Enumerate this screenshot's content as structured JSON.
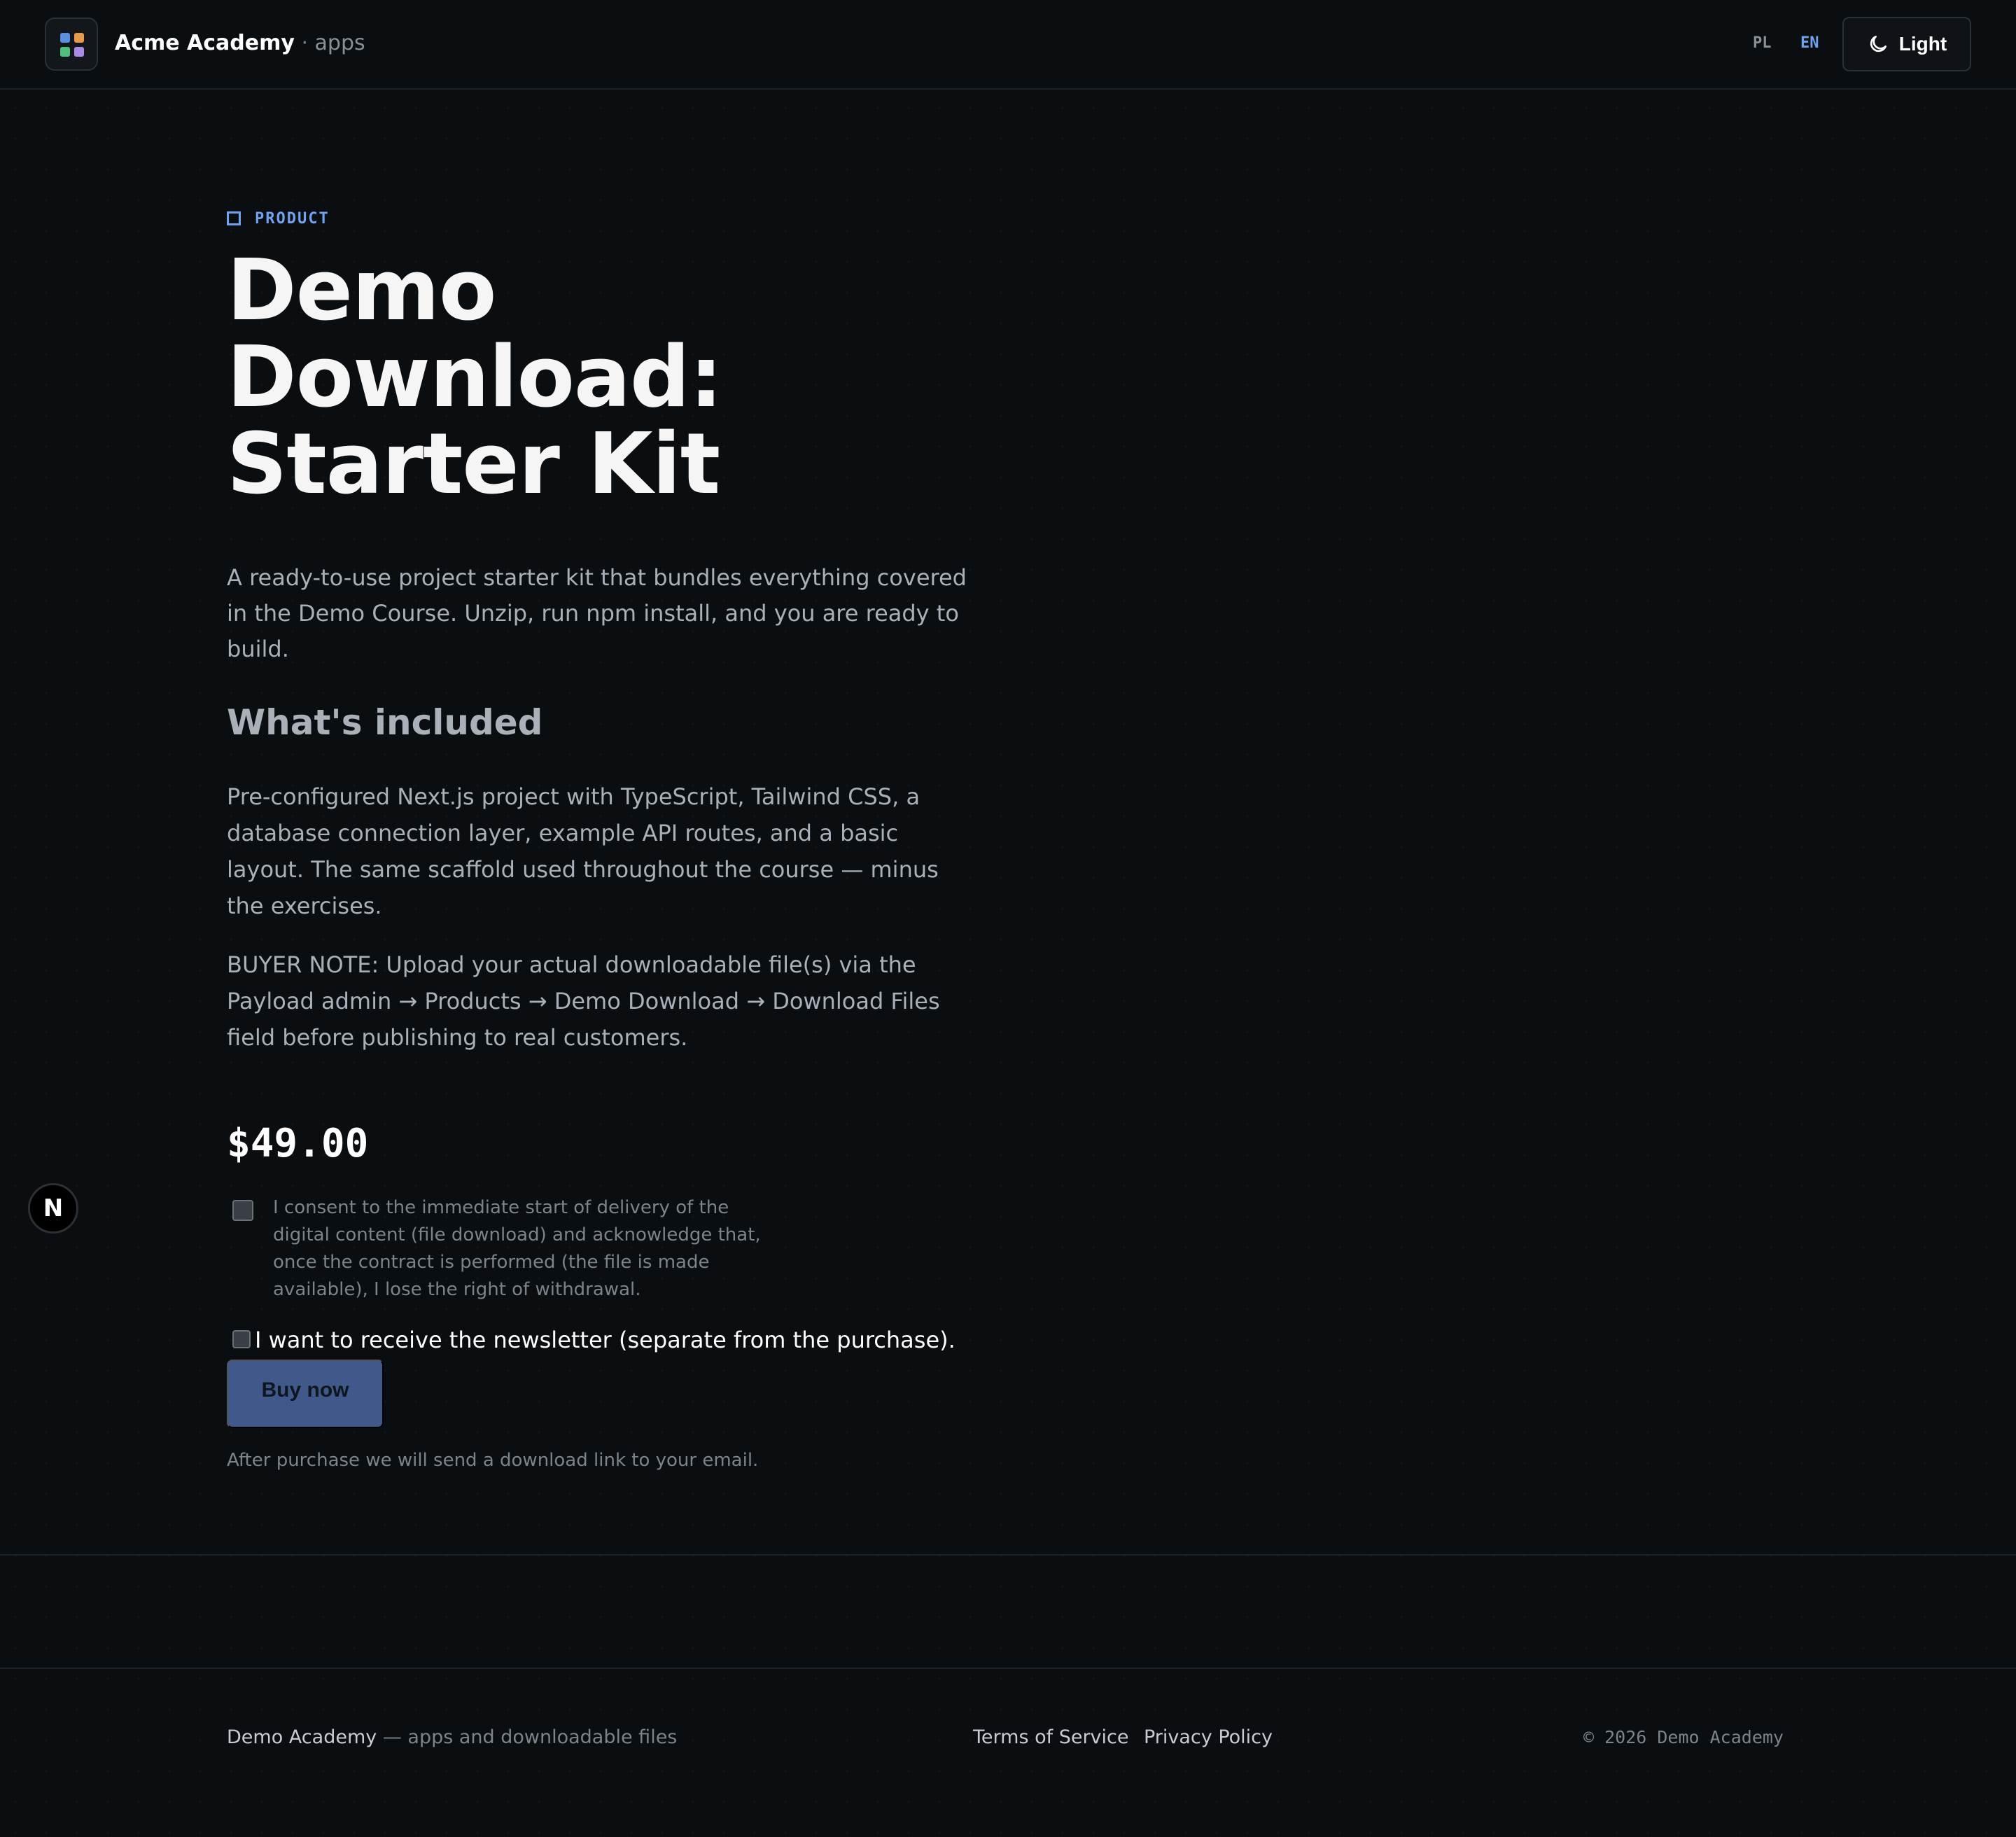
{
  "header": {
    "brand_name": "Acme Academy",
    "brand_separator": " · ",
    "brand_sub": "apps",
    "lang_pl": "PL",
    "lang_en": "EN",
    "theme_toggle_label": "Light",
    "theme_icon": "moon-icon"
  },
  "product": {
    "eyebrow": "PRODUCT",
    "title": "Demo Download: Starter Kit",
    "intro": "A ready-to-use project starter kit that bundles everything covered in the Demo Course. Unzip, run npm install, and you are ready to build.",
    "section_heading": "What's included",
    "paragraph_1": "Pre-configured Next.js project with TypeScript, Tailwind CSS, a database connection layer, example API routes, and a basic layout. The same scaffold used throughout the course — minus the exercises.",
    "paragraph_2": "BUYER NOTE: Upload your actual downloadable file(s) via the Payload admin → Products → Demo Download → Download Files field before publishing to real customers.",
    "price": "$49.00",
    "consent_label": "I consent to the immediate start of delivery of the digital content (file download) and acknowledge that, once the contract is performed (the file is made available), I lose the right of withdrawal.",
    "consent_checked": false,
    "newsletter_label": "I want to receive the newsletter (separate from the purchase).",
    "newsletter_checked": false,
    "buy_button": "Buy now",
    "after_note": "After purchase we will send a download link to your email."
  },
  "badge": {
    "letter": "N"
  },
  "footer": {
    "brand": "Demo Academy",
    "tagline": " — apps and downloadable files",
    "terms": "Terms of Service",
    "privacy": "Privacy Policy",
    "copyright": "© 2026 Demo Academy"
  },
  "colors": {
    "background": "#0b0e11",
    "accent": "#6fa3f0",
    "buy_button": "#40598a",
    "text_muted": "#aab0b8"
  }
}
